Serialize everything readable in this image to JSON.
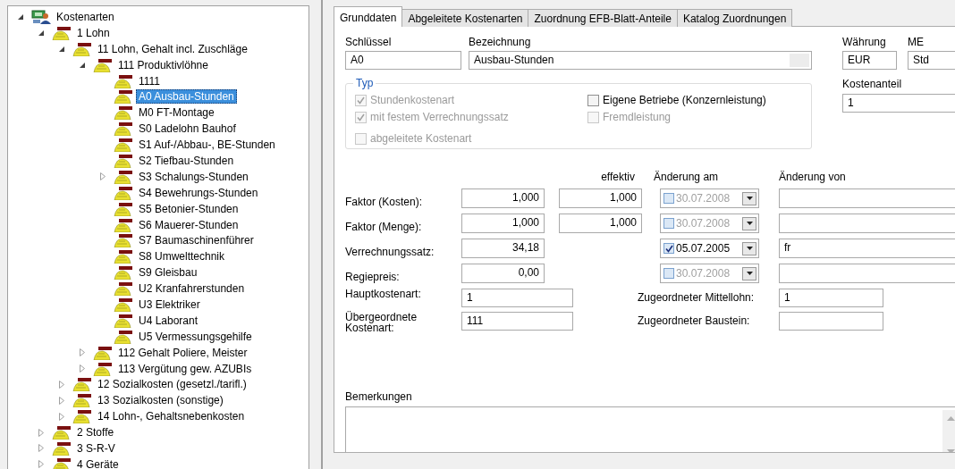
{
  "tree": {
    "label": "Kostenarten",
    "selected": false,
    "expanded": true,
    "children": [
      {
        "label": "1 Lohn",
        "selected": false,
        "expanded": true,
        "children": [
          {
            "label": "11 Lohn, Gehalt incl. Zuschläge",
            "selected": false,
            "expanded": true,
            "children": [
              {
                "label": "111 Produktivlöhne",
                "selected": false,
                "expanded": true,
                "children": [
                  {
                    "label": "1111",
                    "selected": false
                  },
                  {
                    "label": "A0 Ausbau-Stunden",
                    "selected": true
                  },
                  {
                    "label": "M0 FT-Montage",
                    "selected": false
                  },
                  {
                    "label": "S0 Ladelohn Bauhof",
                    "selected": false
                  },
                  {
                    "label": "S1 Auf-/Abbau-, BE-Stunden",
                    "selected": false
                  },
                  {
                    "label": "S2 Tiefbau-Stunden",
                    "selected": false
                  },
                  {
                    "label": "S3 Schalungs-Stunden",
                    "selected": false,
                    "expanded": false
                  },
                  {
                    "label": "S4 Bewehrungs-Stunden",
                    "selected": false
                  },
                  {
                    "label": "S5 Betonier-Stunden",
                    "selected": false
                  },
                  {
                    "label": "S6 Mauerer-Stunden",
                    "selected": false
                  },
                  {
                    "label": "S7 Baumaschinenführer",
                    "selected": false
                  },
                  {
                    "label": "S8 Umwelttechnik",
                    "selected": false
                  },
                  {
                    "label": "S9 Gleisbau",
                    "selected": false
                  },
                  {
                    "label": "U2 Kranfahrerstunden",
                    "selected": false
                  },
                  {
                    "label": "U3 Elektriker",
                    "selected": false
                  },
                  {
                    "label": "U4 Laborant",
                    "selected": false
                  },
                  {
                    "label": "U5 Vermessungsgehilfe",
                    "selected": false
                  }
                ]
              },
              {
                "label": "112 Gehalt Poliere, Meister",
                "selected": false,
                "expanded": false
              },
              {
                "label": "113 Vergütung gew. AZUBIs",
                "selected": false,
                "expanded": false
              }
            ]
          },
          {
            "label": "12 Sozialkosten (gesetzl./tarifl.)",
            "selected": false,
            "expanded": false
          },
          {
            "label": "13 Sozialkosten (sonstige)",
            "selected": false,
            "expanded": false
          },
          {
            "label": "14 Lohn-, Gehaltsnebenkosten",
            "selected": false,
            "expanded": false
          }
        ]
      },
      {
        "label": "2 Stoffe",
        "selected": false,
        "expanded": false
      },
      {
        "label": "3 S-R-V",
        "selected": false,
        "expanded": false
      },
      {
        "label": "4 Geräte",
        "selected": false,
        "expanded": false
      }
    ]
  },
  "tabs": [
    {
      "label": "Grunddaten",
      "selected": true
    },
    {
      "label": "Abgeleitete Kostenarten",
      "selected": false
    },
    {
      "label": "Zuordnung EFB-Blatt-Anteile",
      "selected": false
    },
    {
      "label": "Katalog Zuordnungen",
      "selected": false
    }
  ],
  "header_fields": [
    {
      "label": "Schlüssel",
      "value": "A0"
    },
    {
      "label": "Bezeichnung",
      "value": "Ausbau-Stunden"
    },
    {
      "label": "Währung",
      "value": "EUR"
    },
    {
      "label": "ME",
      "value": "Std"
    }
  ],
  "typ": {
    "title": "Typ",
    "left": [
      {
        "label": "Stundenkostenart",
        "checked": true,
        "disabled": true
      },
      {
        "label": "mit festem Verrechnungssatz",
        "checked": true,
        "disabled": true
      },
      {
        "label": "abgeleitete Kostenart",
        "checked": false,
        "disabled": true
      }
    ],
    "right": [
      {
        "label": "Eigene Betriebe (Konzernleistung)",
        "checked": false,
        "disabled": false
      },
      {
        "label": "Fremdleistung",
        "checked": false,
        "disabled": true
      }
    ]
  },
  "kostenanteil": {
    "label": "Kostenanteil",
    "value": "1"
  },
  "factor_table": {
    "columns": [
      "effektiv",
      "Änderung am",
      "Änderung von"
    ],
    "rows": [
      {
        "label": "Faktor (Kosten):",
        "value": "1,000",
        "effektiv": "1,000",
        "date": {
          "checked": false,
          "value": "30.07.2008"
        }
      },
      {
        "label": "Faktor (Menge):",
        "value": "1,000",
        "effektiv": "1,000",
        "date": {
          "checked": false,
          "value": "30.07.2008"
        }
      },
      {
        "label": "Verrechnungssatz:",
        "value": "34,18",
        "date": {
          "checked": true,
          "value": "05.07.2005"
        },
        "changed_by": "fr"
      },
      {
        "label": "Regiepreis:",
        "value": "0,00",
        "date": {
          "checked": false,
          "value": "30.07.2008"
        }
      }
    ]
  },
  "assignments": [
    {
      "label": "Hauptkostenart:",
      "value": "1",
      "side_label": "Zugeordneter Mittellohn:",
      "side_value": "1"
    },
    {
      "label": "Übergeordnete Kostenart:",
      "value": "111",
      "side_label": "Zugeordneter Baustein:"
    }
  ],
  "remarks": {
    "label": "Bemerkungen"
  }
}
